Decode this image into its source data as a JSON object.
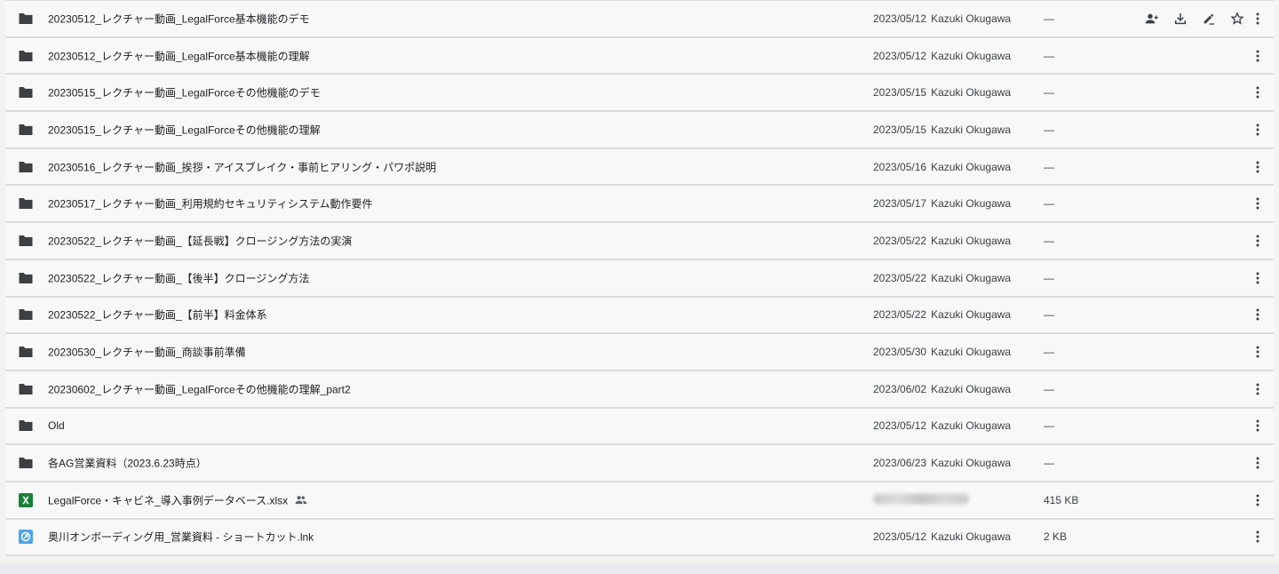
{
  "rows": [
    {
      "name": "20230512_レクチャー動画_LegalForce基本機能のデモ",
      "date": "2023/05/12",
      "owner": "Kazuki Okugawa",
      "size": "—",
      "type": "folder",
      "actions": true
    },
    {
      "name": "20230512_レクチャー動画_LegalForce基本機能の理解",
      "date": "2023/05/12",
      "owner": "Kazuki Okugawa",
      "size": "—",
      "type": "folder"
    },
    {
      "name": "20230515_レクチャー動画_LegalForceその他機能のデモ",
      "date": "2023/05/15",
      "owner": "Kazuki Okugawa",
      "size": "—",
      "type": "folder"
    },
    {
      "name": "20230515_レクチャー動画_LegalForceその他機能の理解",
      "date": "2023/05/15",
      "owner": "Kazuki Okugawa",
      "size": "—",
      "type": "folder"
    },
    {
      "name": "20230516_レクチャー動画_挨拶・アイスブレイク・事前ヒアリング・パワポ説明",
      "date": "2023/05/16",
      "owner": "Kazuki Okugawa",
      "size": "—",
      "type": "folder"
    },
    {
      "name": "20230517_レクチャー動画_利用規約セキュリティシステム動作要件",
      "date": "2023/05/17",
      "owner": "Kazuki Okugawa",
      "size": "—",
      "type": "folder"
    },
    {
      "name": "20230522_レクチャー動画_【延長戦】クロージング方法の実演",
      "date": "2023/05/22",
      "owner": "Kazuki Okugawa",
      "size": "—",
      "type": "folder"
    },
    {
      "name": "20230522_レクチャー動画_【後半】クロージング方法",
      "date": "2023/05/22",
      "owner": "Kazuki Okugawa",
      "size": "—",
      "type": "folder"
    },
    {
      "name": "20230522_レクチャー動画_【前半】料金体系",
      "date": "2023/05/22",
      "owner": "Kazuki Okugawa",
      "size": "—",
      "type": "folder"
    },
    {
      "name": "20230530_レクチャー動画_商談事前準備",
      "date": "2023/05/30",
      "owner": "Kazuki Okugawa",
      "size": "—",
      "type": "folder"
    },
    {
      "name": "20230602_レクチャー動画_LegalForceその他機能の理解_part2",
      "date": "2023/06/02",
      "owner": "Kazuki Okugawa",
      "size": "—",
      "type": "folder"
    },
    {
      "name": "Old",
      "date": "2023/05/12",
      "owner": "Kazuki Okugawa",
      "size": "—",
      "type": "folder"
    },
    {
      "name": "各AG営業資料（2023.6.23時点）",
      "date": "2023/06/23",
      "owner": "Kazuki Okugawa",
      "size": "—",
      "type": "folder"
    },
    {
      "name": "LegalForce・キャビネ_導入事例データベース.xlsx",
      "date": "",
      "owner": "",
      "size": "415 KB",
      "type": "xlsx",
      "shared": true,
      "blurred": true
    },
    {
      "name": "奥川オンボーディング用_営業資料 - ショートカット.lnk",
      "date": "2023/05/12",
      "owner": "Kazuki Okugawa",
      "size": "2 KB",
      "type": "lnk"
    }
  ],
  "icons": {
    "folder": "folder-icon",
    "xlsx": "excel-file-icon",
    "lnk": "shortcut-file-icon",
    "share": "add-person-icon",
    "download": "download-icon",
    "rename": "rename-icon",
    "star": "star-icon",
    "more": "more-vert-icon",
    "shared": "shared-people-icon"
  },
  "colors": {
    "folder": "#3c4043",
    "excel": "#188038",
    "shortcut": "#4285f4"
  }
}
